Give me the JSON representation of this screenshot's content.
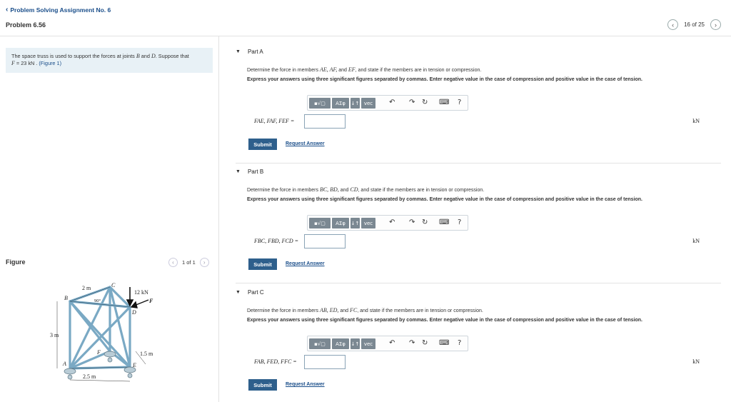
{
  "header": {
    "back_label": "Problem Solving Assignment No. 6",
    "problem_title": "Problem 6.56",
    "pager_text": "16 of 25"
  },
  "statement": {
    "text_1": "The space truss is used to support the forces at joints ",
    "joint_b": "B",
    "text_2": " and ",
    "joint_d": "D",
    "text_3": ". Suppose that",
    "force_expr": "F",
    "force_value": " = 23  kN",
    "text_4": " . ",
    "figure_link": "(Figure 1)"
  },
  "figure": {
    "label": "Figure",
    "pager_text": "1 of 1",
    "dims": {
      "top": "2 m",
      "angle": "90°",
      "load": "12 kN",
      "height": "3 m",
      "depth": "1.5 m",
      "bottom": "2.5 m"
    },
    "joints": {
      "a": "A",
      "b": "B",
      "c": "C",
      "d": "D",
      "e": "E",
      "f": "F",
      "force": "F"
    }
  },
  "toolbar": {
    "greek": "ΑΣφ",
    "sort": "↓↑",
    "vec": "vec",
    "undo": "↶",
    "redo": "↷",
    "reset": "↻",
    "keyboard": "⌨",
    "help": "?"
  },
  "parts": [
    {
      "title": "Part A",
      "q_prefix": "Determine the force in members ",
      "q_members": "AE, AF,",
      "q_and": " and ",
      "q_last": "EF",
      "q_suffix": ", and state if the members are in tension or compression.",
      "instruction": "Express your answers using three significant figures separated by commas. Enter negative value in the case of compression and positive value in the case of tension.",
      "answer_label": "FAE, FAF, FEF =",
      "answer_value": "",
      "unit": "kN",
      "submit": "Submit",
      "request": "Request Answer"
    },
    {
      "title": "Part B",
      "q_prefix": "Determine the force in members ",
      "q_members": "BC, BD,",
      "q_and": " and ",
      "q_last": "CD",
      "q_suffix": ", and state if the members are in tension or compression.",
      "instruction": "Express your answers using three significant figures separated by commas. Enter negative value in the case of compression and positive value in the case of tension.",
      "answer_label": "FBC, FBD, FCD =",
      "answer_value": "",
      "unit": "kN",
      "submit": "Submit",
      "request": "Request Answer"
    },
    {
      "title": "Part C",
      "q_prefix": "Determine the force in members ",
      "q_members": "AB, ED,",
      "q_and": " and ",
      "q_last": "FC",
      "q_suffix": ", and state if the members are in tension or compression.",
      "instruction": "Express your answers using three significant figures separated by commas. Enter negative value in the case of compression and positive value in the case of tension.",
      "answer_label": "FAB, FED, FFC =",
      "answer_value": "",
      "unit": "kN",
      "submit": "Submit",
      "request": "Request Answer"
    }
  ]
}
